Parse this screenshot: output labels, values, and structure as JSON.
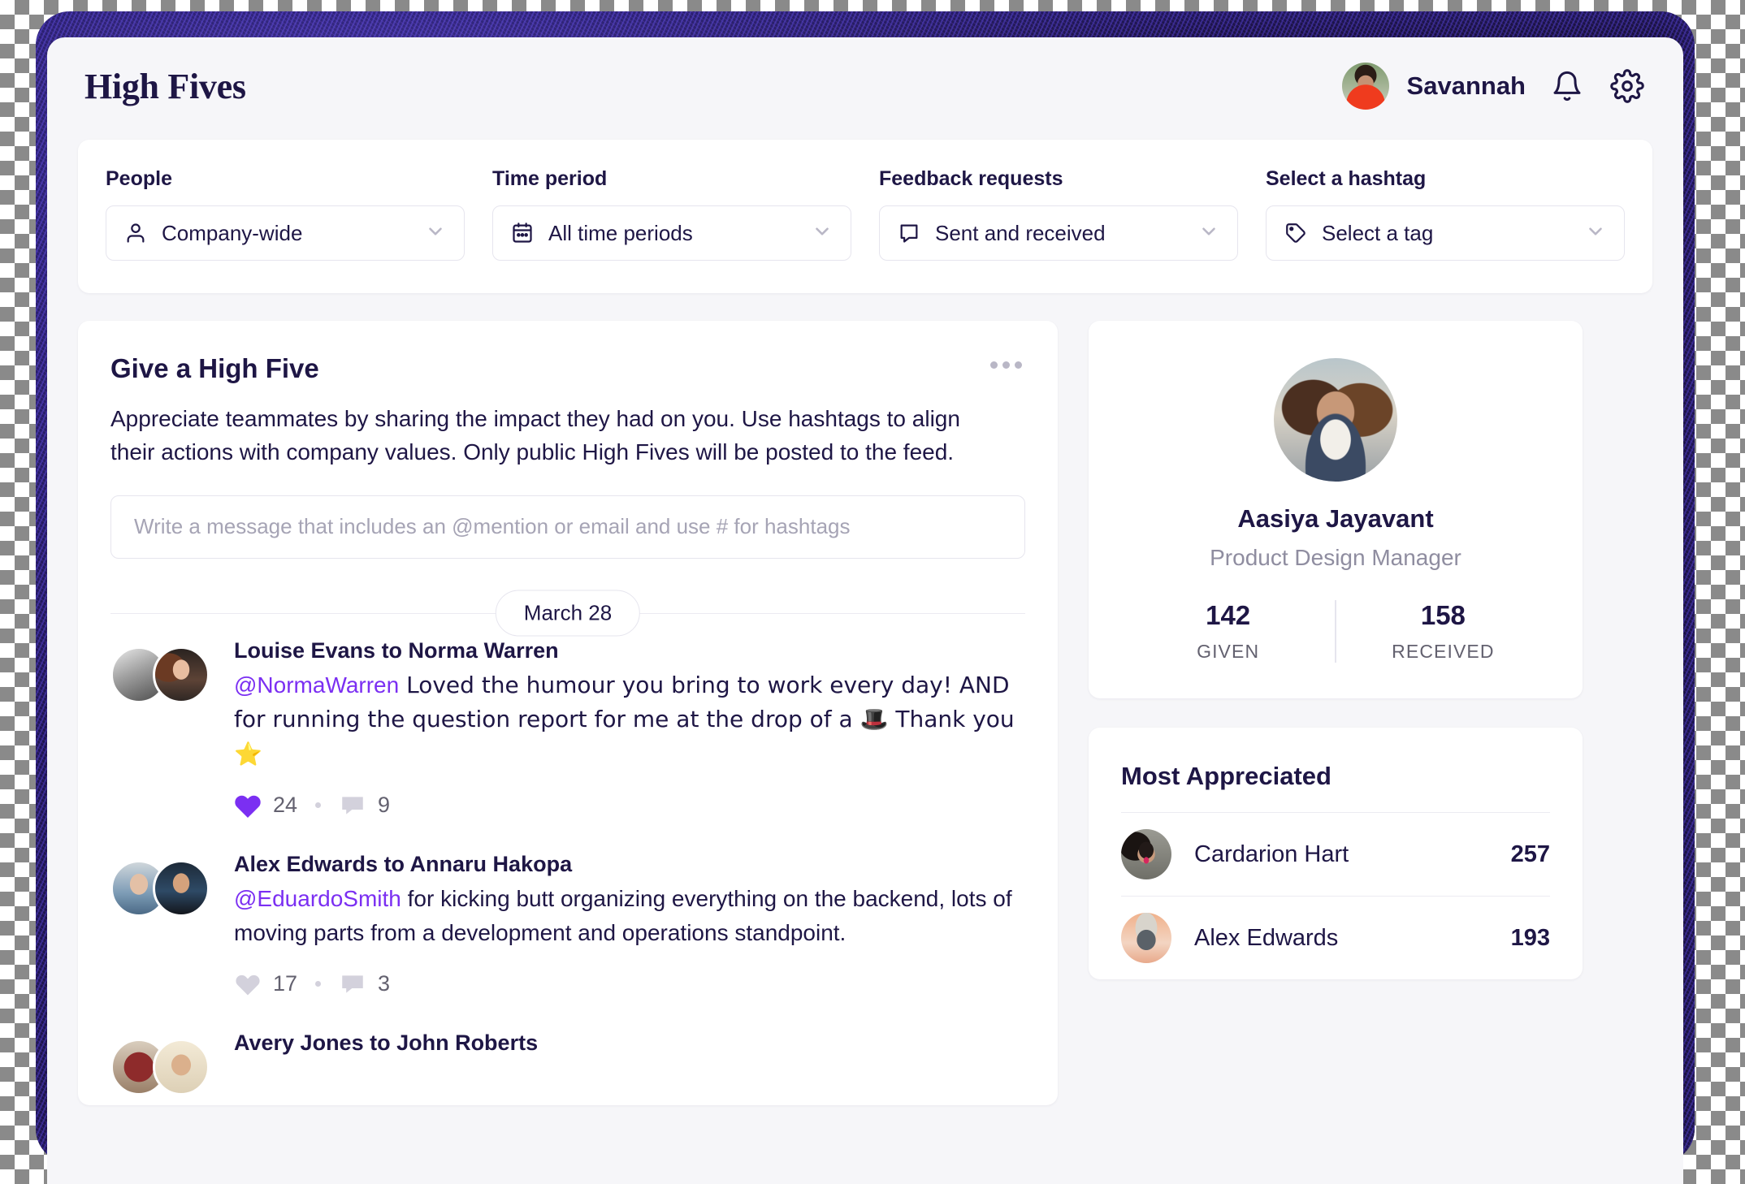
{
  "header": {
    "title": "High Fives",
    "user_name": "Savannah",
    "notifications_icon": "bell-icon",
    "settings_icon": "gear-icon"
  },
  "filters": [
    {
      "label": "People",
      "icon": "person-icon",
      "value": "Company-wide"
    },
    {
      "label": "Time period",
      "icon": "calendar-icon",
      "value": "All time periods"
    },
    {
      "label": "Feedback requests",
      "icon": "comment-icon",
      "value": "Sent and received"
    },
    {
      "label": "Select a hashtag",
      "icon": "tag-icon",
      "value": "Select a tag"
    }
  ],
  "give": {
    "title": "Give a High Five",
    "description": "Appreciate teammates by sharing the impact they had on you. Use hashtags to align their actions with company values. Only public High Fives will be posted to the feed.",
    "input_placeholder": "Write a message that includes an @mention or email and use # for hashtags",
    "menu_icon": "more-options-icon"
  },
  "feed": {
    "date_divider": "March 28",
    "posts": [
      {
        "title": "Louise Evans to Norma Warren",
        "mention": "@NormaWarren",
        "body": " Loved the humour you bring to work every day! AND for running the question report for me at the drop of a 🎩 Thank you ⭐",
        "likes": "24",
        "comments": "9",
        "liked": true
      },
      {
        "title": "Alex Edwards to Annaru Hakopa",
        "mention": "@EduardoSmith",
        "body": " for kicking butt organizing everything on the backend, lots of moving parts from a development and operations standpoint.",
        "likes": "17",
        "comments": "3",
        "liked": false
      },
      {
        "title": "Avery Jones to John Roberts",
        "mention": "",
        "body": "",
        "likes": "",
        "comments": "",
        "liked": false
      }
    ]
  },
  "profile": {
    "name": "Aasiya Jayavant",
    "role": "Product Design Manager",
    "given_value": "142",
    "given_label": "GIVEN",
    "received_value": "158",
    "received_label": "RECEIVED"
  },
  "most_appreciated": {
    "title": "Most Appreciated",
    "rows": [
      {
        "name": "Cardarion Hart",
        "score": "257"
      },
      {
        "name": "Alex Edwards",
        "score": "193"
      }
    ]
  },
  "colors": {
    "accent_purple": "#7b2ff2",
    "text_navy": "#1e1645",
    "muted": "#8f8da0",
    "page_bg": "#f6f6f9"
  }
}
